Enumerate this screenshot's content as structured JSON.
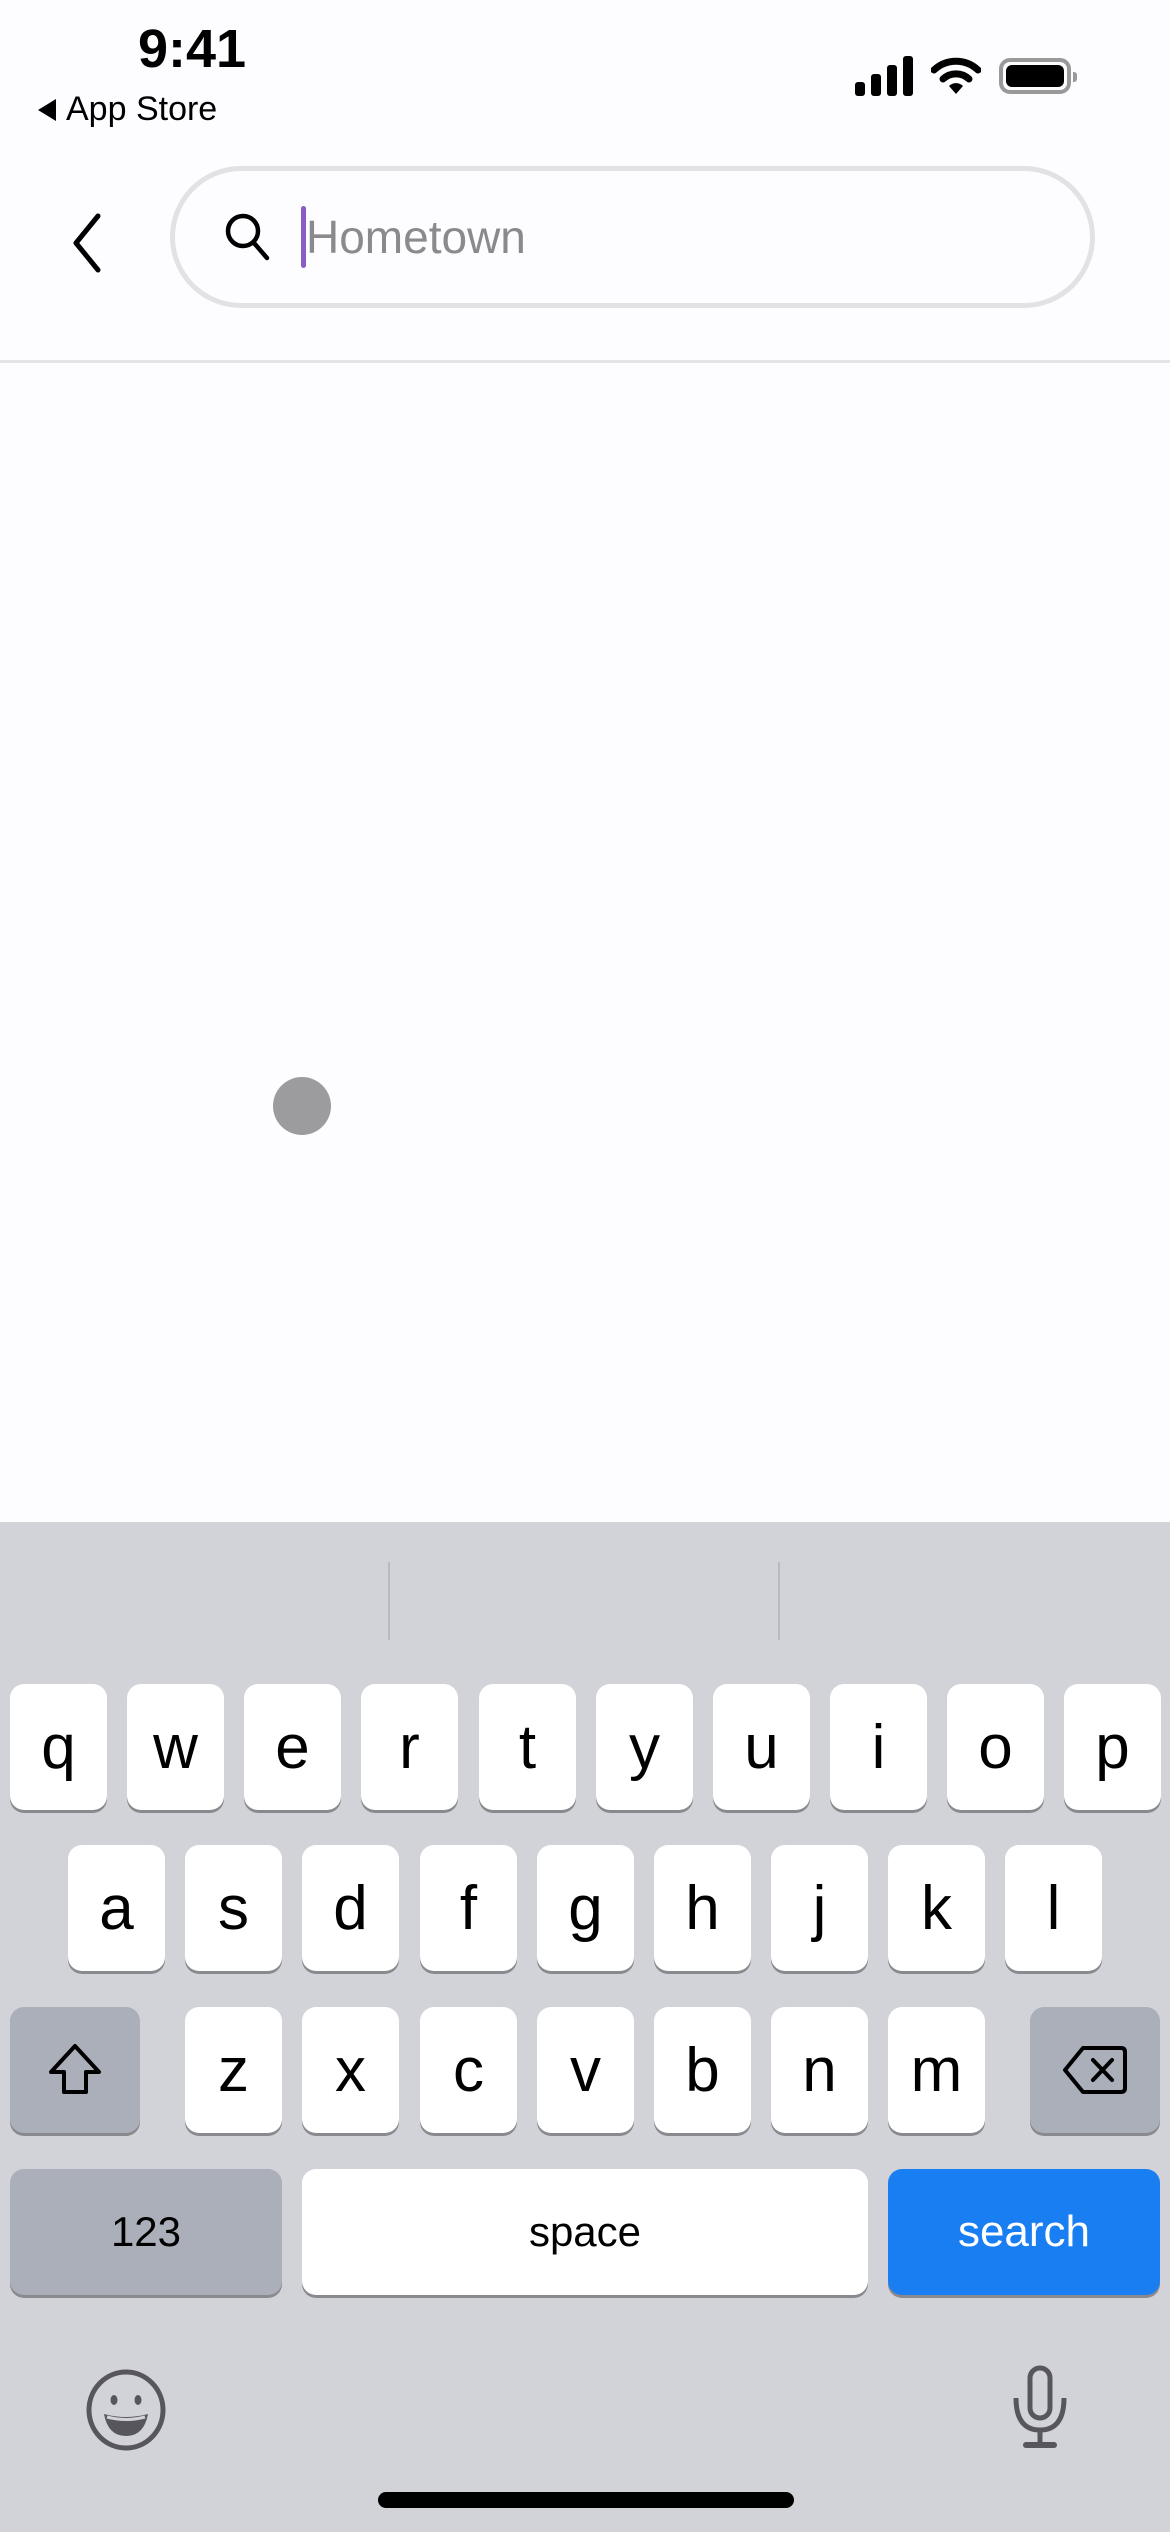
{
  "status_bar": {
    "time": "9:41",
    "back_app_label": "App Store",
    "signal_icon": "cellular-signal-icon",
    "wifi_icon": "wifi-icon",
    "battery_icon": "battery-full-icon"
  },
  "header": {
    "back_icon": "chevron-left-icon",
    "search": {
      "icon": "search-icon",
      "value": "",
      "placeholder": "Hometown",
      "cursor_color": "#8a5cc4"
    }
  },
  "keyboard": {
    "row1": [
      "q",
      "w",
      "e",
      "r",
      "t",
      "y",
      "u",
      "i",
      "o",
      "p"
    ],
    "row2": [
      "a",
      "s",
      "d",
      "f",
      "g",
      "h",
      "j",
      "k",
      "l"
    ],
    "row3": [
      "z",
      "x",
      "c",
      "v",
      "b",
      "n",
      "m"
    ],
    "shift_icon": "shift-arrow-icon",
    "delete_icon": "backspace-icon",
    "numbers_label": "123",
    "space_label": "space",
    "return_label": "search",
    "return_color": "#1a7ef3",
    "emoji_icon": "emoji-smiley-icon",
    "dictation_icon": "microphone-icon"
  }
}
